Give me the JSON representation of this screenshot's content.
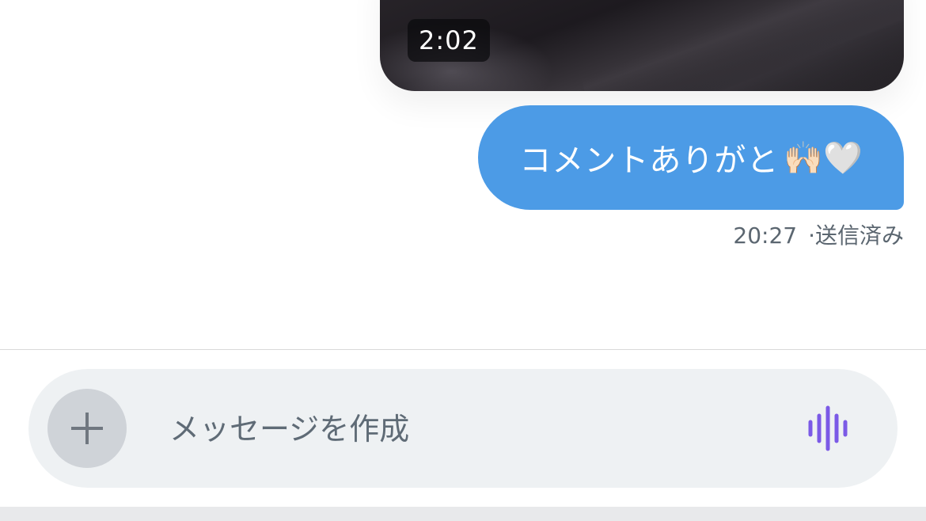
{
  "video": {
    "duration": "2:02"
  },
  "message": {
    "text": "コメントありがと",
    "emoji": "🙌🏻🤍",
    "time": "20:27",
    "separator": "·",
    "status": "送信済み",
    "bubble_color": "#4c9be6"
  },
  "composer": {
    "placeholder": "メッセージを作成",
    "add_icon": "plus-icon",
    "voice_icon": "waveform-icon",
    "voice_icon_color": "#7b5ae6"
  }
}
